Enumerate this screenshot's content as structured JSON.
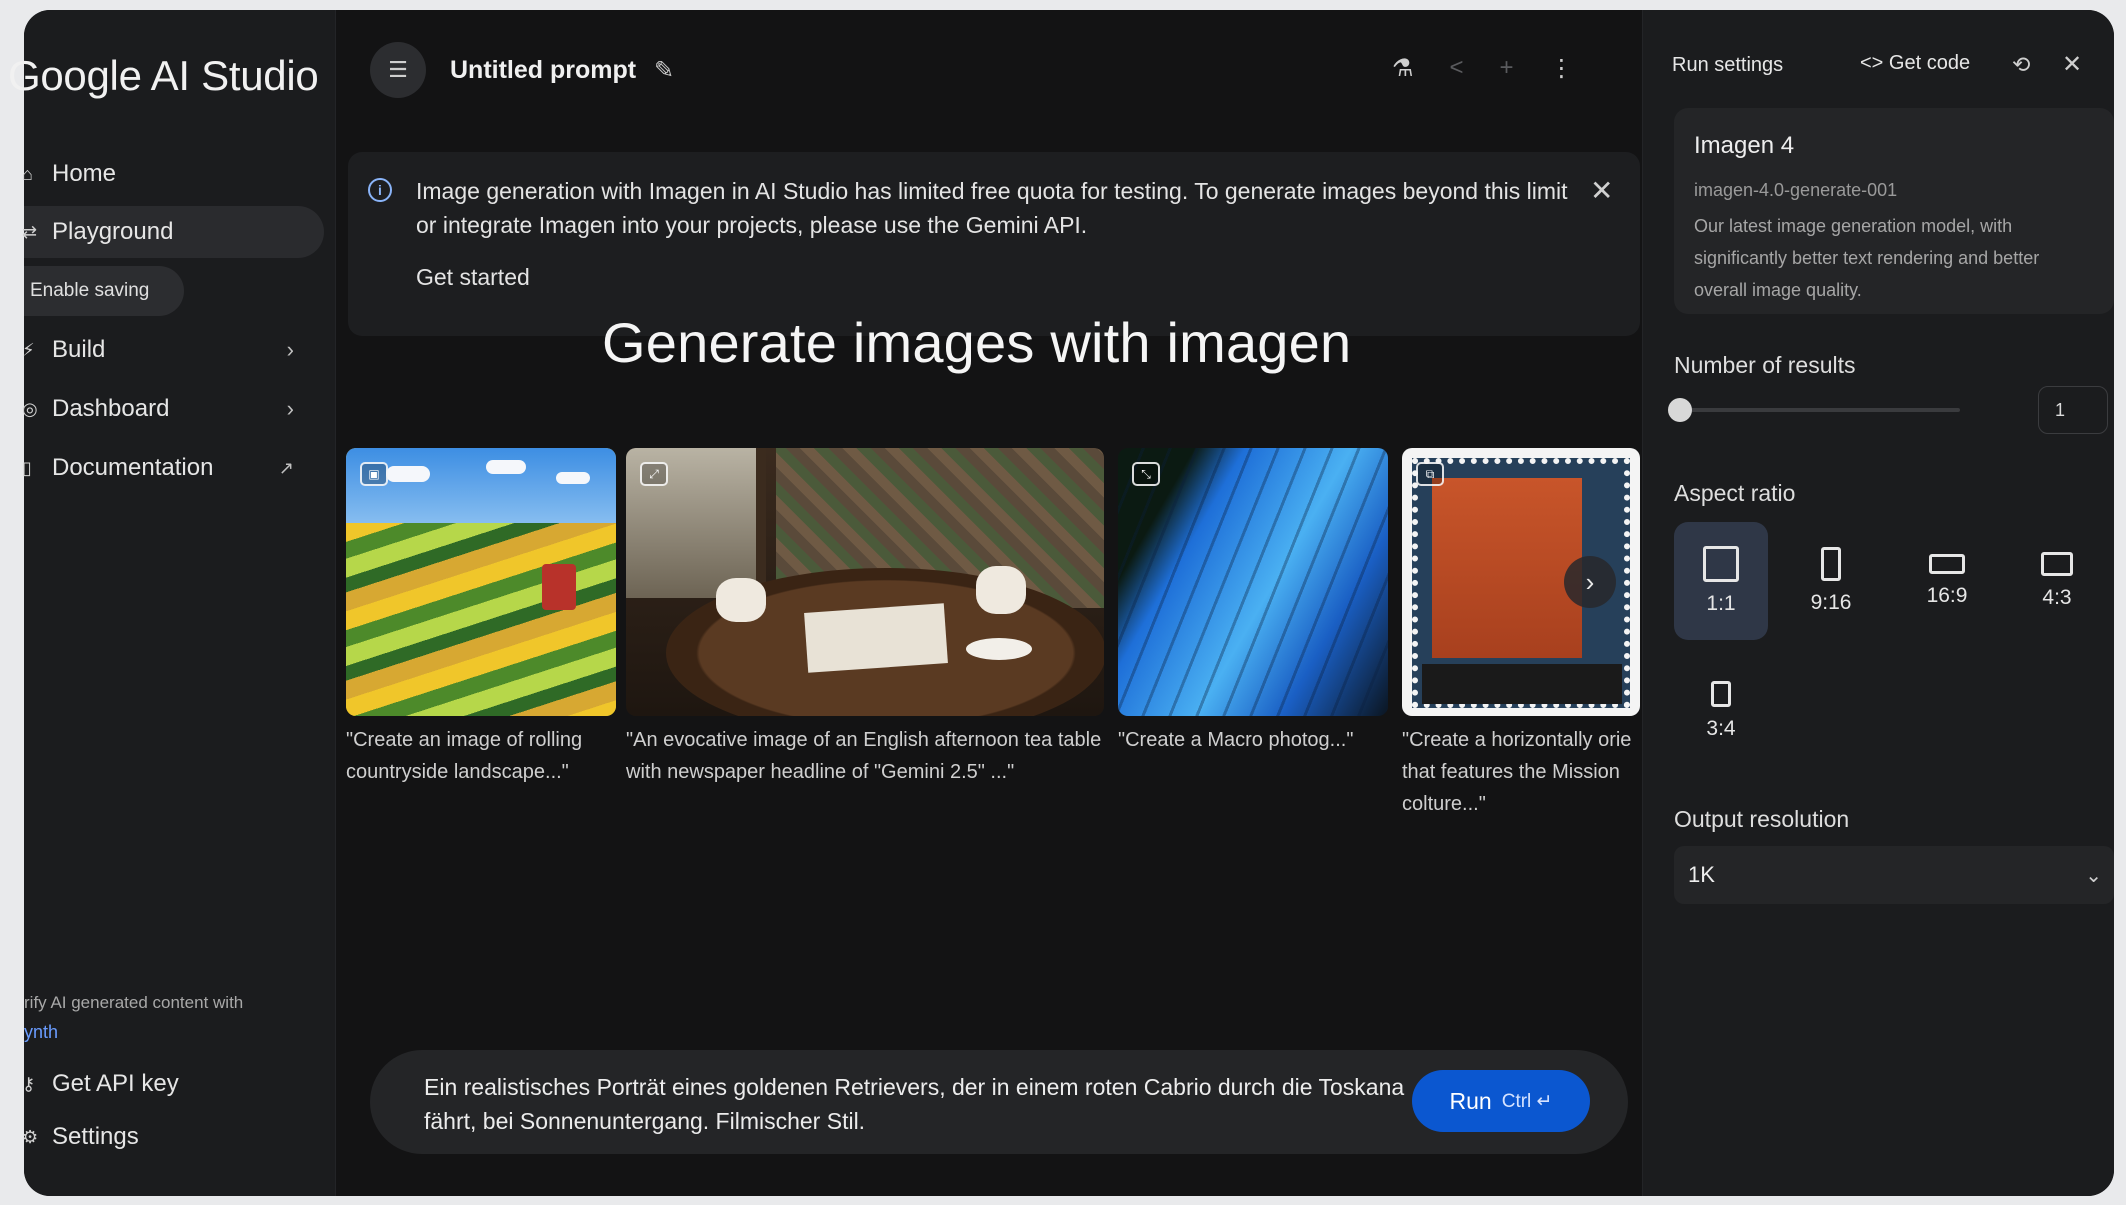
{
  "app": {
    "brand": "Google AI Studio"
  },
  "sidebar": {
    "items": [
      {
        "label": "Home"
      },
      {
        "label": "Playground"
      },
      {
        "label": "Build"
      },
      {
        "label": "Dashboard"
      },
      {
        "label": "Documentation"
      }
    ],
    "enable_saving": "Enable saving",
    "note": "rify AI generated content with",
    "note_link": "ynth",
    "get_api_key": "Get API key",
    "settings": "Settings"
  },
  "header": {
    "title": "Untitled prompt"
  },
  "banner": {
    "text": "Image generation with Imagen in AI Studio has limited free quota for testing. To generate images beyond this limit or integrate Imagen into your projects, please use the Gemini API.",
    "cta": "Get started"
  },
  "main": {
    "heading": "Generate images with imagen",
    "examples": [
      {
        "caption": "\"Create an image of rolling countryside landscape...\""
      },
      {
        "caption": "\"An evocative image of an English afternoon tea table with newspaper headline of \"Gemini 2.5\" ...\""
      },
      {
        "caption": "\"Create a Macro photog...\""
      },
      {
        "caption": "\"Create a horizontally orie that features the Mission colture...\""
      }
    ]
  },
  "composer": {
    "text": "Ein realistisches Porträt eines goldenen Retrievers, der in einem roten Cabrio durch die Toskana fährt, bei Sonnenuntergang. Filmischer Stil.",
    "run_label": "Run",
    "run_shortcut": "Ctrl ↵"
  },
  "run_settings": {
    "title": "Run settings",
    "get_code": "Get code",
    "model": {
      "name": "Imagen 4",
      "id": "imagen-4.0-generate-001",
      "description": "Our latest image generation model, with significantly better text rendering and better overall image quality."
    },
    "num_results_label": "Number of results",
    "num_results_value": "1",
    "num_results_fraction": 0,
    "aspect_label": "Aspect ratio",
    "aspect_options": [
      "1:1",
      "9:16",
      "16:9",
      "4:3",
      "3:4"
    ],
    "aspect_selected": "1:1",
    "resolution_label": "Output resolution",
    "resolution_value": "1K"
  },
  "colors": {
    "accent": "#0b57d0",
    "info": "#8ab4f8",
    "background": "#131314"
  }
}
